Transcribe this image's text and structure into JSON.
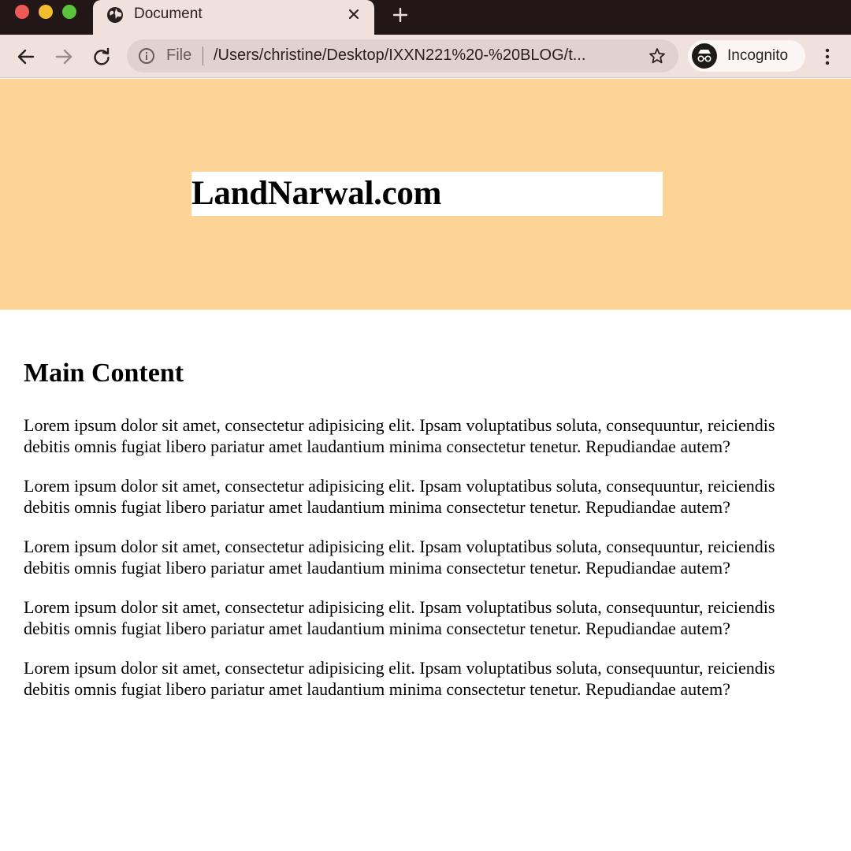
{
  "browser": {
    "tab": {
      "title": "Document"
    },
    "toolbar": {
      "scheme_label": "File",
      "url": "/Users/christine/Desktop/IXXN221%20-%20BLOG/t...",
      "incognito_label": "Incognito"
    },
    "colors": {
      "titlebar": "#221616",
      "toolbar": "#f1e1dc",
      "omnibox": "#e2d2cd"
    },
    "icons": [
      "globe-icon",
      "close-icon",
      "plus-icon",
      "back-arrow-icon",
      "forward-arrow-icon",
      "reload-icon",
      "info-icon",
      "star-icon",
      "incognito-icon",
      "kebab-menu-icon"
    ]
  },
  "page": {
    "hero": {
      "site_title": "LandNarwal.com",
      "background": "#fdd396"
    },
    "main": {
      "heading": "Main Content",
      "paragraphs": [
        "Lorem ipsum dolor sit amet, consectetur adipisicing elit. Ipsam voluptatibus soluta, consequuntur, reiciendis debitis omnis fugiat libero pariatur amet laudantium minima consectetur tenetur. Repudiandae autem?",
        "Lorem ipsum dolor sit amet, consectetur adipisicing elit. Ipsam voluptatibus soluta, consequuntur, reiciendis debitis omnis fugiat libero pariatur amet laudantium minima consectetur tenetur. Repudiandae autem?",
        "Lorem ipsum dolor sit amet, consectetur adipisicing elit. Ipsam voluptatibus soluta, consequuntur, reiciendis debitis omnis fugiat libero pariatur amet laudantium minima consectetur tenetur. Repudiandae autem?",
        "Lorem ipsum dolor sit amet, consectetur adipisicing elit. Ipsam voluptatibus soluta, consequuntur, reiciendis debitis omnis fugiat libero pariatur amet laudantium minima consectetur tenetur. Repudiandae autem?",
        "Lorem ipsum dolor sit amet, consectetur adipisicing elit. Ipsam voluptatibus soluta, consequuntur, reiciendis debitis omnis fugiat libero pariatur amet laudantium minima consectetur tenetur. Repudiandae autem?"
      ]
    }
  }
}
